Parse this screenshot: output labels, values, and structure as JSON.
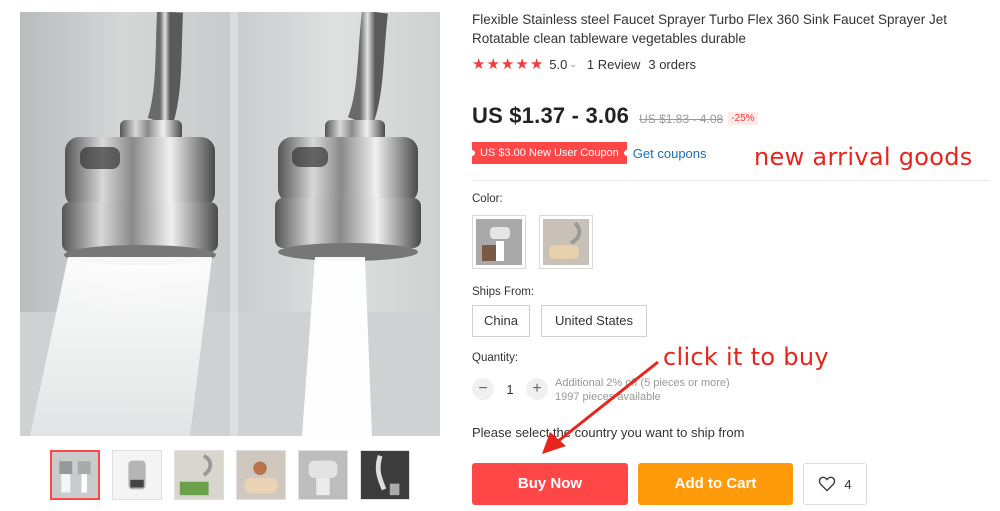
{
  "product": {
    "title": "Flexible Stainless steel Faucet Sprayer Turbo Flex 360 Sink Faucet Sprayer Jet Rotatable clean tableware vegetables durable",
    "rating_value": "5.0",
    "reviews": "1 Review",
    "orders": "3 orders"
  },
  "price": {
    "current": "US $1.37 - 3.06",
    "original": "US $1.83 - 4.08",
    "discount": "-25%"
  },
  "coupon": {
    "label": "US $3.00 New User Coupon",
    "link": "Get coupons"
  },
  "options": {
    "color_label": "Color:",
    "ships_from_label": "Ships From:",
    "ships_from": [
      "China",
      "United States"
    ],
    "quantity_label": "Quantity:",
    "quantity": "1",
    "quantity_note_1": "Additional 2% off (5 pieces or more)",
    "quantity_note_2": "1997 pieces available"
  },
  "shipping_note": "Please select the country you want to ship from",
  "actions": {
    "buy_now": "Buy Now",
    "add_to_cart": "Add to Cart",
    "wishlist_count": "4"
  },
  "annotations": {
    "new_arrival": "new arrival goods",
    "click_to_buy": "click it to buy"
  },
  "icons": {
    "star": "star-icon",
    "chevron": "chevron-down-icon",
    "heart": "heart-icon",
    "minus": "minus-icon",
    "plus": "plus-icon"
  },
  "colors": {
    "accent_red": "#ff4747",
    "cart_orange": "#ff9a0a",
    "link_blue": "#1b6fb5",
    "annotation_red": "#e8241b"
  }
}
